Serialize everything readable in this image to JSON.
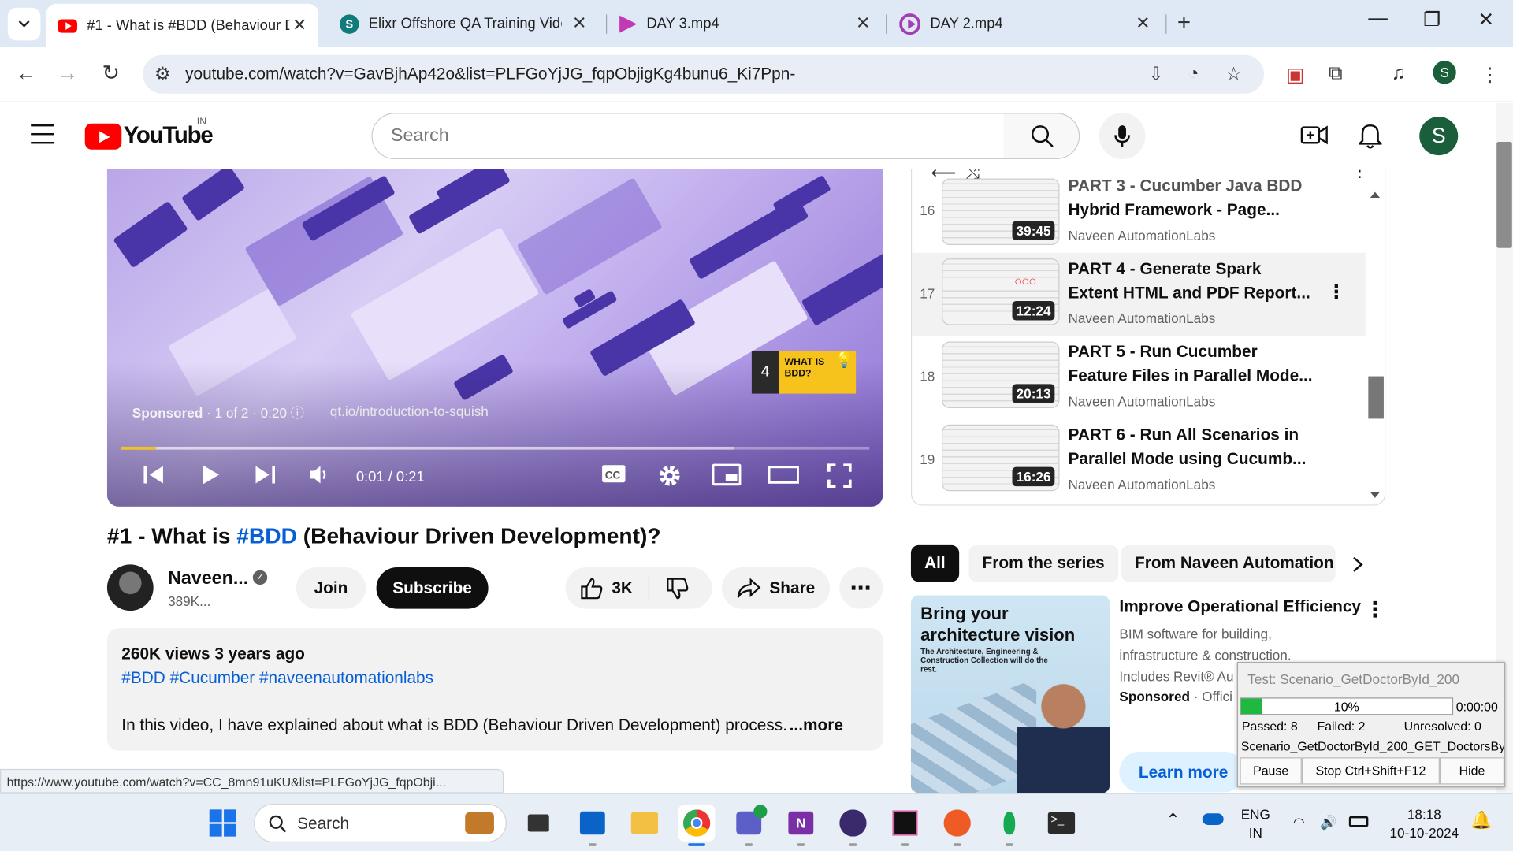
{
  "browser": {
    "tabs": [
      {
        "title": "#1 - What is #BDD (Behaviour Driven Development)?",
        "close": "✕"
      },
      {
        "title": "Elixr Offshore QA Training Videos",
        "close": "✕"
      },
      {
        "title": "DAY 3.mp4",
        "close": "✕"
      },
      {
        "title": "DAY 2.mp4",
        "close": "✕"
      }
    ],
    "url": "youtube.com/watch?v=GavBjhAp42o&list=PLFGoYjJG_fqpObjigKg4bunu6_Ki7Ppn-",
    "profile_initial": "S",
    "status_url": "https://www.youtube.com/watch?v=CC_8mn91uKU&list=PLFGoYjJG_fqpObji..."
  },
  "youtube": {
    "logo_text": "YouTube",
    "country_code": "IN",
    "search_placeholder": "Search",
    "avatar_initial": "S"
  },
  "player": {
    "sponsored_label": "Sponsored",
    "ad_info": " · 1 of 2 · 0:20 ⓘ",
    "ad_url": "qt.io/introduction-to-squish",
    "time": "0:01 / 0:21",
    "progress_fraction": 0.048,
    "next_index": "4",
    "next_thumb_text": "WHAT IS BDD?"
  },
  "video": {
    "title_prefix": "#1 - What is ",
    "title_tag": "#BDD",
    "title_suffix": " (Behaviour Driven Development)?",
    "channel": "Naveen...",
    "subscribers": "389K...",
    "join": "Join",
    "subscribe": "Subscribe",
    "likes": "3K",
    "share": "Share",
    "stats": "260K views  3 years ago",
    "hashtags": "#BDD #Cucumber #naveenautomationlabs",
    "description": "In this video, I have explained about what is BDD (Behaviour Driven Development) process.",
    "more": "...more"
  },
  "playlist": {
    "items": [
      {
        "index": "16",
        "title": "PART 3 - Cucumber Java BDD Hybrid Framework - Page...",
        "title_line1": "Hybrid Framework - Page...",
        "channel": "Naveen AutomationLabs",
        "duration": "39:45"
      },
      {
        "index": "17",
        "title_line1": "PART 4 - Generate Spark",
        "title_line2": "Extent HTML and PDF Report...",
        "channel": "Naveen AutomationLabs",
        "duration": "12:24"
      },
      {
        "index": "18",
        "title_line1": "PART 5 - Run Cucumber",
        "title_line2": "Feature Files in Parallel Mode...",
        "channel": "Naveen AutomationLabs",
        "duration": "20:13"
      },
      {
        "index": "19",
        "title_line1": "PART 6 - Run All Scenarios in",
        "title_line2": "Parallel Mode using Cucumb...",
        "channel": "Naveen AutomationLabs",
        "duration": "16:26"
      }
    ]
  },
  "chips": [
    "All",
    "From the series",
    "From Naveen Automation"
  ],
  "ad": {
    "image_headline": "Bring your architecture vision",
    "image_sub": "The Architecture, Engineering & Construction Collection will do the rest.",
    "title": "Improve Operational Efficiency",
    "desc1": "BIM software for building,",
    "desc2": "infrastructure & construction.",
    "desc3": "Includes Revit® Au",
    "sponsored": "Sponsored",
    "official": " · Offici",
    "learn_more": "Learn more"
  },
  "test_runner": {
    "title": "Test: Scenario_GetDoctorById_200",
    "percent": "10%",
    "progress_fraction": 0.1,
    "elapsed": "0:00:00",
    "passed": "Passed: 8",
    "failed": "Failed: 2",
    "unresolved": "Unresolved: 0",
    "current": "Scenario_GetDoctorById_200_GET_DoctorsBy",
    "pause": "Pause",
    "stop": "Stop Ctrl+Shift+F12",
    "hide": "Hide"
  },
  "taskbar": {
    "search_label": "Search",
    "lang1": "ENG",
    "lang2": "IN",
    "time": "18:18",
    "date": "10-10-2024"
  },
  "colors": {
    "youtube_red": "#ff0000",
    "link_blue": "#065fd4",
    "progress_yellow": "#f3c21a",
    "runner_green": "#1fb840",
    "avatar_green": "#1b5e3b"
  }
}
